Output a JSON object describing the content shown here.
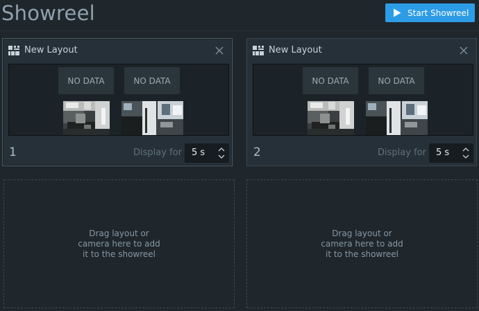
{
  "header": {
    "title": "Showreel",
    "start_button_label": "Start Showreel",
    "accent_color": "#2d9ce6"
  },
  "icons": {
    "start": "play-icon",
    "layout": "layout-grid-icon",
    "close": "close-icon",
    "spin_up": "chevron-up-icon",
    "spin_down": "chevron-down-icon"
  },
  "layouts": [
    {
      "name": "New Layout",
      "number": "1",
      "display_label": "Display for",
      "duration": "5 s",
      "tiles": [
        "NO DATA",
        "NO DATA"
      ],
      "cameras": [
        "camera-preview-kitchen",
        "camera-preview-office"
      ]
    },
    {
      "name": "New Layout",
      "number": "2",
      "display_label": "Display for",
      "duration": "5 s",
      "tiles": [
        "NO DATA",
        "NO DATA"
      ],
      "cameras": [
        "camera-preview-kitchen",
        "camera-preview-office"
      ]
    }
  ],
  "drop_zones": [
    {
      "lines": [
        "Drag layout or",
        "camera here to add",
        "it to the showreel"
      ]
    },
    {
      "lines": [
        "Drag layout or",
        "camera here to add",
        "it to the showreel"
      ]
    }
  ]
}
